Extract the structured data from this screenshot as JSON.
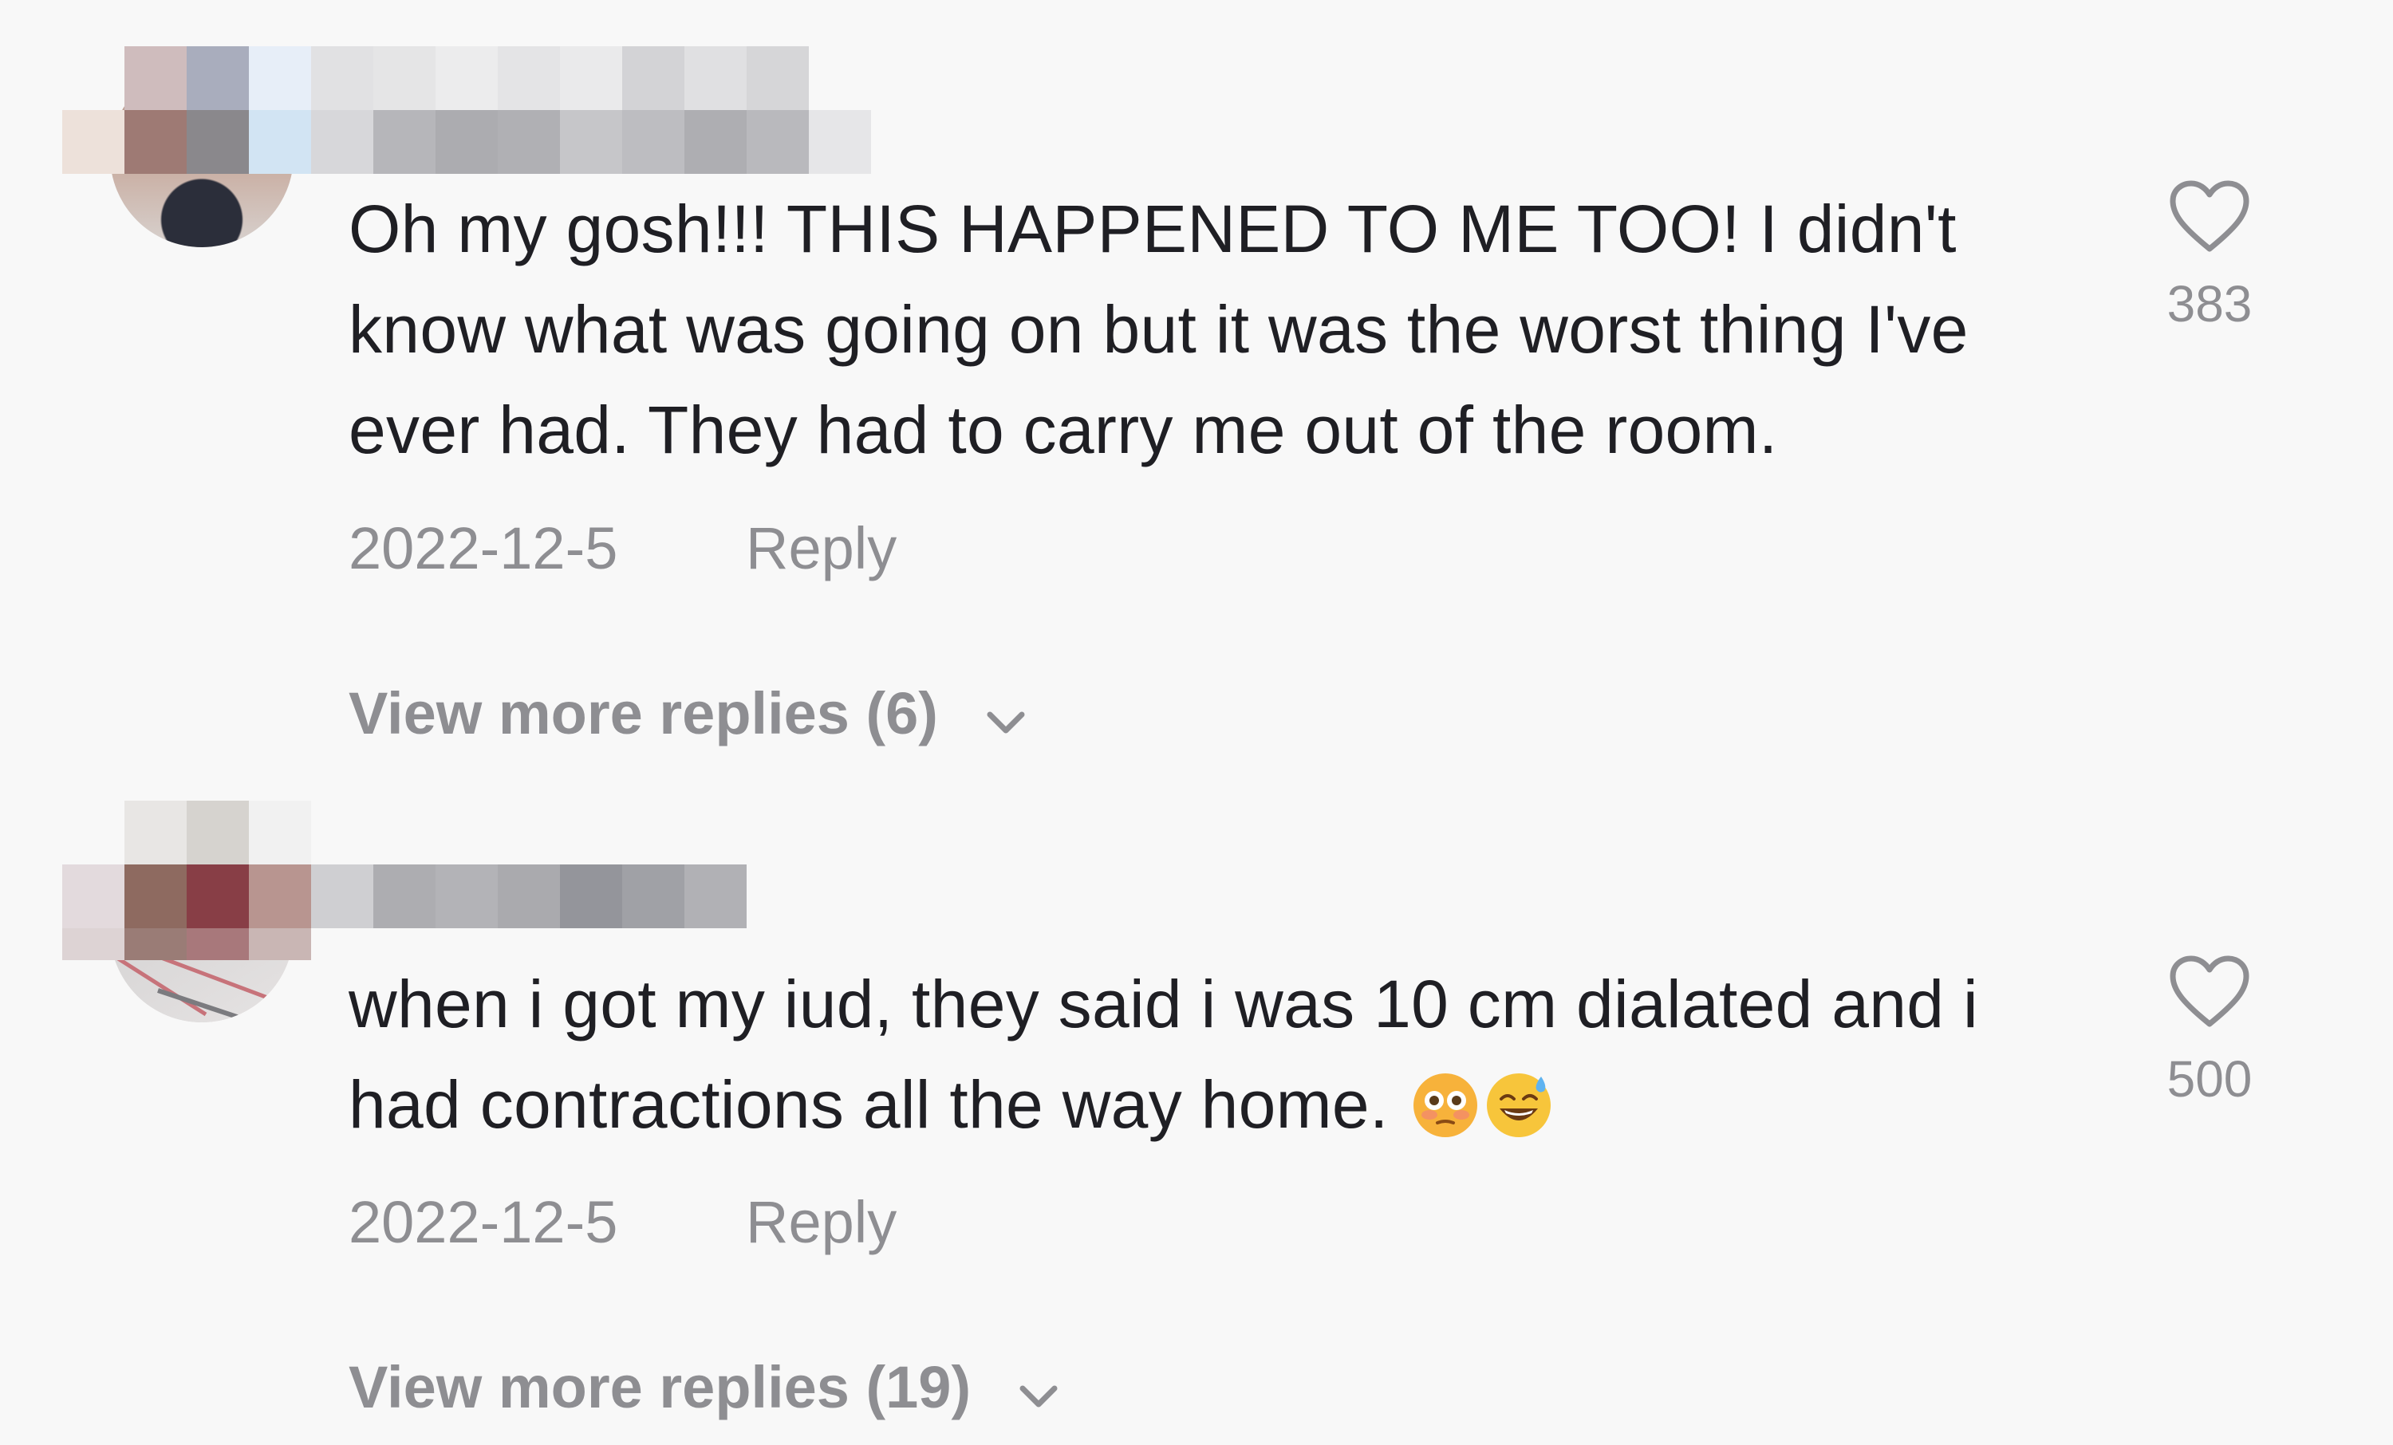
{
  "comments": [
    {
      "text": "Oh my gosh!!! THIS HAPPENED TO ME TOO! I didn't know what was going on but it was the worst thing I've ever had. They had to carry me out of the room.",
      "date": "2022-12-5",
      "reply_label": "Reply",
      "likes": "383",
      "view_more": "View more replies (6)"
    },
    {
      "text": "when i got my iud, they said i was 10 cm dialated and i had contractions all the way home.",
      "emojis": [
        "flushed-face-emoji",
        "grinning-sweat-emoji"
      ],
      "date": "2022-12-5",
      "reply_label": "Reply",
      "likes": "500",
      "view_more": "View more replies (19)"
    }
  ],
  "icons": {
    "like": "heart-outline-icon",
    "expand": "chevron-down-icon"
  },
  "colors": {
    "background": "#f8f8f8",
    "text": "#1f1f24",
    "muted": "#8e8e92"
  }
}
